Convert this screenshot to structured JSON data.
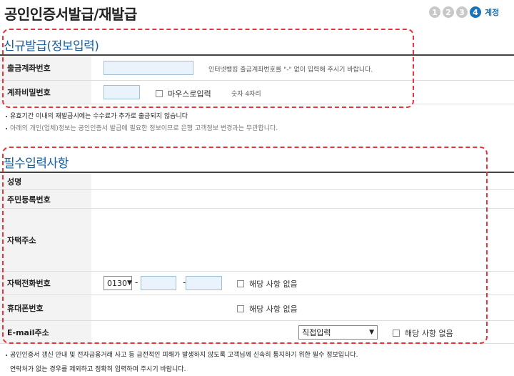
{
  "header": {
    "title": "공인인증서발급/재발급",
    "steps": [
      "1",
      "2",
      "3",
      "4"
    ],
    "active_step_label": "계정"
  },
  "section_new": {
    "title": "신규발급(정보입력)",
    "account_number_label": "출금계좌번호",
    "account_number_value": "",
    "account_number_hint": "인터넷뱅킹 출금계좌번호를 \"-\" 없이 입력해 주시기 바랍니다.",
    "password_label": "계좌비밀번호",
    "password_value": "",
    "mouse_input_label": "마우스로입력",
    "password_hint": "숫자 4자리"
  },
  "notes_top": [
    "유효기간 이내의 재발급시에는 수수료가 추가로 출금되지 않습니다",
    "아래의 개인(업체)정보는 공인인증서 발급에 필요한 정보이므로 은행 고객정보 변경과는 무관합니다."
  ],
  "section_required": {
    "title": "필수입력사항",
    "name_label": "성명",
    "ssn_label": "주민등록번호",
    "address_label": "자택주소",
    "home_phone_label": "자택전화번호",
    "home_phone_area": "0130",
    "home_phone_dash1": "-",
    "home_phone_dash2": "-",
    "mobile_label": "휴대폰번호",
    "email_label": "E-mail주소",
    "email_domain_select": "직접입력",
    "not_applicable": "해당 사항 없음"
  },
  "notes_bottom": [
    "공인인증서 갱신 안내 및 전자금융거래 사고 등 금전적인 피해가 발생하지 않도록 고객님께 신속히 통지하기 위한 필수 정보입니다.",
    "연락처가 없는 경우를 제외하고 정확히 입력하여 주시기 바랍니다."
  ],
  "colors": {
    "accent": "#1a73b8",
    "section_title": "#1a5fa0",
    "highlight_border": "#e8333a",
    "label_bg": "#f3f3f3",
    "input_bg": "#eaf3fb"
  }
}
